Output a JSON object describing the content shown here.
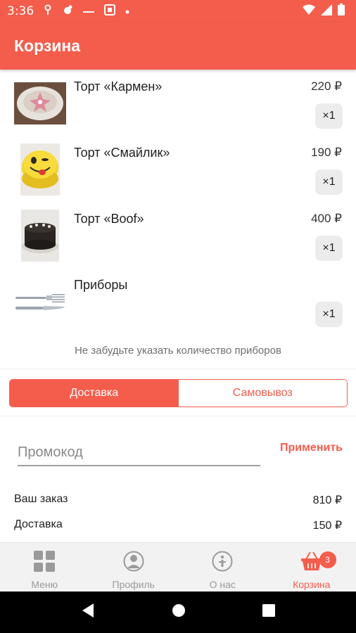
{
  "status": {
    "time": "3:36"
  },
  "app_bar": {
    "title": "Корзина"
  },
  "cart": {
    "items": [
      {
        "name": "Торт «Кармен»",
        "price": "220 ₽",
        "qty": "×1"
      },
      {
        "name": "Торт «Смайлик»",
        "price": "190 ₽",
        "qty": "×1"
      },
      {
        "name": "Торт «Boof»",
        "price": "400 ₽",
        "qty": "×1"
      },
      {
        "name": "Приборы",
        "price": "",
        "qty": "×1"
      }
    ],
    "cutlery_note": "Не забудьте указать количество приборов"
  },
  "delivery_toggle": {
    "delivery": "Доставка",
    "pickup": "Самовывоз",
    "selected": "Доставка"
  },
  "promo": {
    "placeholder": "Промокод",
    "value": "",
    "apply_label": "Применить"
  },
  "summary": {
    "order_label": "Ваш заказ",
    "order_value": "810 ₽",
    "delivery_label": "Доставка",
    "delivery_value": "150 ₽"
  },
  "bottom_nav": {
    "items": [
      {
        "label": "Меню",
        "icon": "grid-icon"
      },
      {
        "label": "Профиль",
        "icon": "profile-icon"
      },
      {
        "label": "О нас",
        "icon": "info-icon"
      },
      {
        "label": "Корзина",
        "icon": "basket-icon"
      }
    ],
    "cart_badge": "3",
    "active": "Корзина"
  },
  "colors": {
    "accent": "#f45d4c",
    "nav_bg": "#f2f2f2",
    "qty_bg": "#ececec"
  }
}
